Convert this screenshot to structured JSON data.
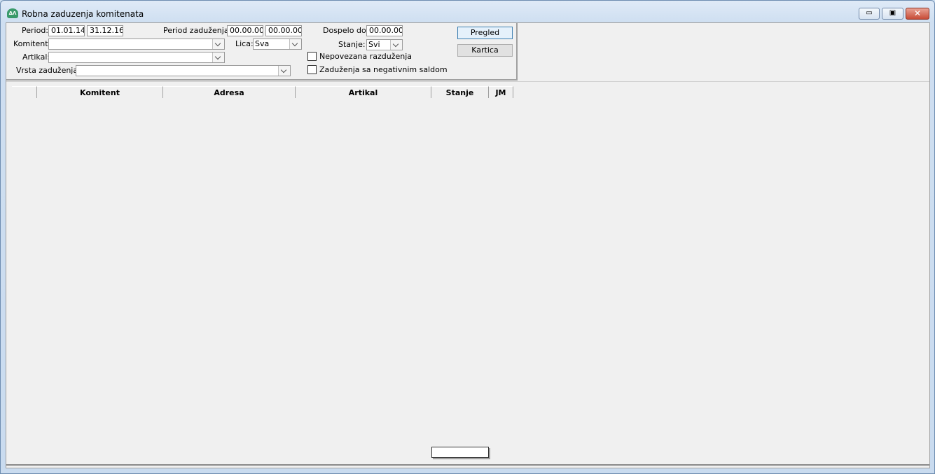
{
  "window": {
    "title": "Robna zaduzenja komitenata",
    "icon": "app-logo-icon",
    "min_glyph": "▭",
    "max_glyph": "▣",
    "close_glyph": "✕"
  },
  "filters": {
    "period_label": "Period:",
    "period_from": "01.01.14",
    "period_to": "31.12.16",
    "period_zaduzenja_label": "Period zaduženja:",
    "period_zaduzenja_from": "00.00.00",
    "period_zaduzenja_to": "00.00.00",
    "dospelo_label": "Dospelo do:",
    "dospelo_value": "00.00.00",
    "komitent_label": "Komitent:",
    "komitent_value": "",
    "lica_label": "Lica:",
    "lica_value": "Sva",
    "stanje_label": "Stanje:",
    "stanje_value": "Svi",
    "artikal_label": "Artikal:",
    "artikal_value": "",
    "vrsta_label": "Vrsta zaduženja:",
    "vrsta_value": "",
    "nepovezana_label": "Nepovezana razduženja",
    "nepovezana_checked": false,
    "negativni_label": "Zaduženja sa negativnim saldom",
    "negativni_checked": false
  },
  "buttons": {
    "pregled": "Pregled",
    "kartica": "Kartica"
  },
  "grid": {
    "columns": [
      "",
      "Komitent",
      "Adresa",
      "Artikal",
      "Stanje",
      "JM"
    ],
    "rows": []
  },
  "status": {
    "value": ""
  }
}
